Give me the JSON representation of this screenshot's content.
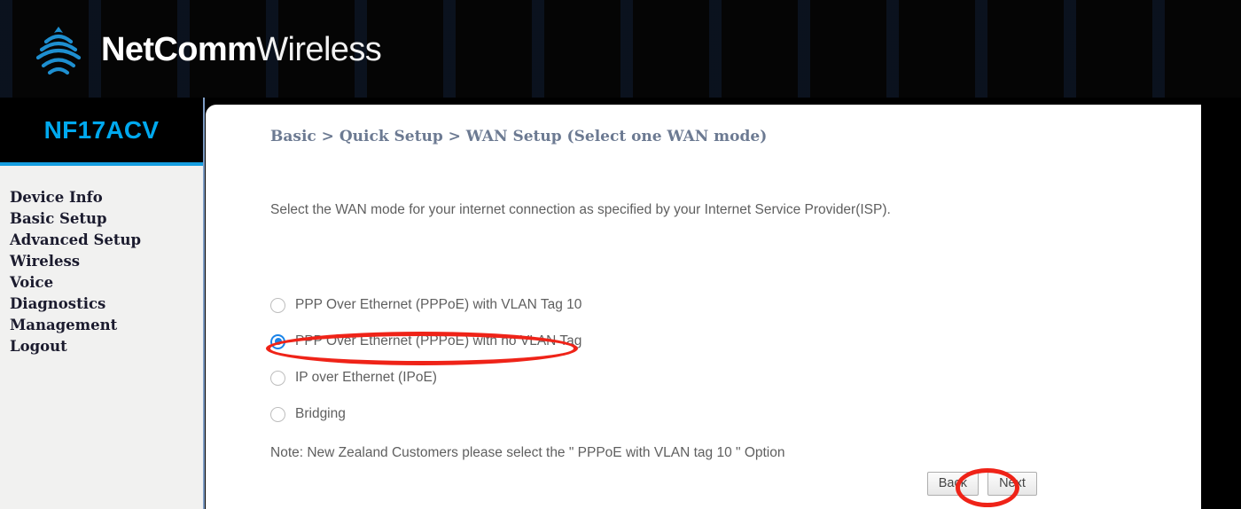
{
  "header": {
    "logo_icon": "netcomm-signal-arcs-icon",
    "brand_bold": "NetComm",
    "brand_light": "Wireless"
  },
  "sidebar": {
    "device_model": "NF17ACV",
    "items": [
      {
        "label": "Device Info"
      },
      {
        "label": "Basic Setup"
      },
      {
        "label": "Advanced Setup"
      },
      {
        "label": "Wireless"
      },
      {
        "label": "Voice"
      },
      {
        "label": "Diagnostics"
      },
      {
        "label": "Management"
      },
      {
        "label": "Logout"
      }
    ]
  },
  "main": {
    "breadcrumb": "Basic > Quick Setup > WAN Setup (Select one WAN mode)",
    "intro": "Select the WAN mode for your internet connection as specified by your Internet Service Provider(ISP).",
    "wan_mode_options": [
      {
        "label": "PPP Over Ethernet (PPPoE) with VLAN Tag 10",
        "selected": false
      },
      {
        "label": "PPP Over Ethernet (PPPoE) with no VLAN Tag",
        "selected": true
      },
      {
        "label": "IP over Ethernet (IPoE)",
        "selected": false
      },
      {
        "label": "Bridging",
        "selected": false
      }
    ],
    "note": "Note: New Zealand Customers please select the \" PPPoE with VLAN tag 10 \" Option",
    "buttons": {
      "back_label": "Back",
      "next_label": "Next"
    }
  },
  "annotations": {
    "color": "#ef2318",
    "targets": [
      "selected-wan-mode-radio",
      "next-button"
    ]
  },
  "colors": {
    "header_bg": "#050505",
    "device_name": "#00a9ef",
    "sidebar_bg": "#f1f1f0",
    "sidebar_divider": "#159ee0",
    "breadcrumb": "#6c7a92",
    "body_text": "#5f5f5f",
    "radio_selected": "#1a83e8",
    "annotation_red": "#ef2318"
  }
}
